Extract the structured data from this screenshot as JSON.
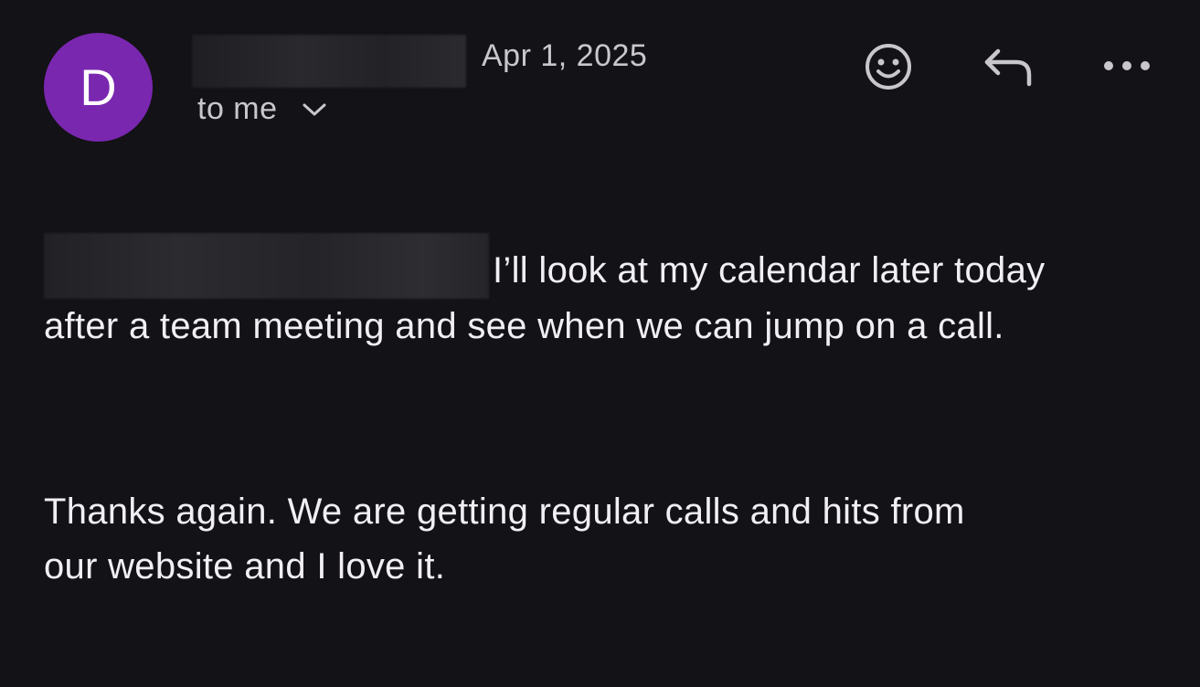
{
  "header": {
    "avatar_letter": "D",
    "avatar_color": "#7a27b0",
    "date": "Apr 1, 2025",
    "recipient": "to me",
    "icons": {
      "chevron": "chevron-down-icon",
      "emoji": "emoji-icon",
      "reply": "reply-icon",
      "more": "more-horizontal-icon"
    }
  },
  "message": {
    "paragraph1_line1": "I’ll look at my calendar later today",
    "paragraph1_line2": "after a team meeting and see when we can jump on a call.",
    "paragraph2_line1": "Thanks again. We are getting regular calls and hits from",
    "paragraph2_line2": "our website and I love it."
  },
  "colors": {
    "background": "#131216",
    "text": "#f1eff3",
    "muted_text": "#c9c7cc"
  }
}
